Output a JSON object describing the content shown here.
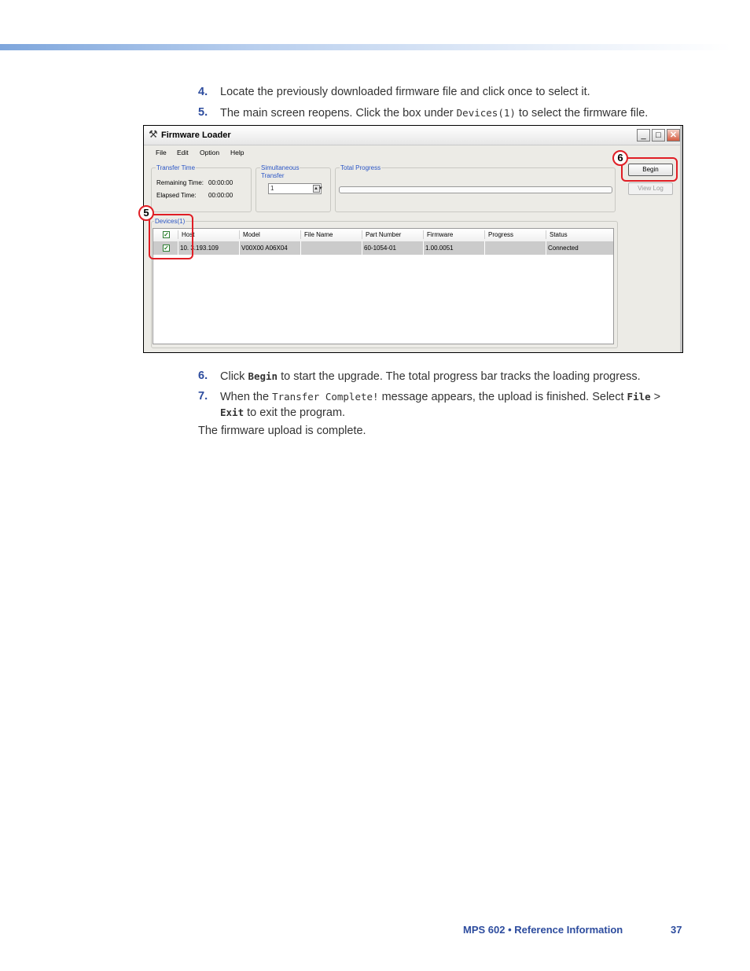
{
  "steps": [
    {
      "num": "4.",
      "text": "Locate the previously downloaded firmware file and click once to select it."
    },
    {
      "num": "5.",
      "text_a": "The main screen reopens. Click the box under ",
      "code": "Devices(1)",
      "text_b": " to select the firmware file."
    },
    {
      "num": "6.",
      "text_a": "Click ",
      "code": "Begin",
      "text_b": " to start the upgrade. The total progress bar tracks the loading progress."
    },
    {
      "num": "7.",
      "text_a": "When the ",
      "code1": "Transfer Complete!",
      "text_b": " message appears, the upload is finished. Select ",
      "code2": "File",
      "sep": " > ",
      "code3": "Exit",
      "text_c": " to exit the program."
    }
  ],
  "closing": "The firmware upload is complete.",
  "window": {
    "title": "Firmware Loader",
    "menus": [
      "File",
      "Edit",
      "Option",
      "Help"
    ],
    "transfer_time": {
      "label": "Transfer Time",
      "remaining_label": "Remaining Time:",
      "remaining": "00:00:00",
      "elapsed_label": "Elapsed Time:",
      "elapsed": "00:00:00"
    },
    "simultaneous": {
      "label_1": "Simultaneous",
      "label_2": "Transfer",
      "value": "1"
    },
    "total_progress": {
      "label": "Total Progress",
      "value": 0
    },
    "buttons": {
      "begin": "Begin",
      "view_log": "View Log"
    },
    "devices": {
      "label": "Devices(1)",
      "columns": [
        "Host",
        "Model",
        "File Name",
        "Part Number",
        "Firmware",
        "Progress",
        "Status"
      ],
      "rows": [
        {
          "host": "10.  3.193.109",
          "model": "V00X00 A06X04",
          "file_name": "",
          "part_number": "60-1054-01",
          "firmware": "1.00.0051",
          "progress": "",
          "status": "Connected"
        }
      ]
    }
  },
  "callouts": {
    "devices": "5",
    "begin": "6"
  },
  "colors": {
    "callout": "#e01e25",
    "step_number": "#2d4c9e",
    "group_label": "#2a55c5"
  },
  "footer": {
    "title": "MPS 602 • Reference Information",
    "page": "37"
  }
}
